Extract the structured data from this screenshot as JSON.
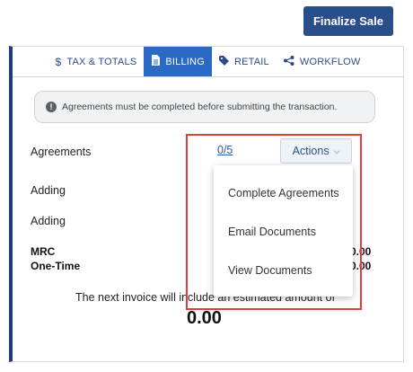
{
  "header": {
    "finalize_label": "Finalize Sale"
  },
  "tabs": [
    {
      "label": "TAX & TOTALS",
      "icon": "dollar-icon",
      "active": false
    },
    {
      "label": "BILLING",
      "icon": "document-icon",
      "active": true
    },
    {
      "label": "RETAIL",
      "icon": "tag-icon",
      "active": false
    },
    {
      "label": "WORKFLOW",
      "icon": "workflow-icon",
      "active": false
    }
  ],
  "notice": {
    "text": "Agreements must be completed before submitting the transaction."
  },
  "agreements": {
    "label": "Agreements",
    "count": "0/5",
    "actions_label": "Actions"
  },
  "rows": {
    "adding_1": "Adding",
    "adding_2": "Adding"
  },
  "totals": {
    "mrc_label": "MRC",
    "onetime_label": "One-Time",
    "mrc_value": "0.00",
    "onetime_value": "0.00",
    "next_invoice_text": "The next invoice will include an estimated amount of",
    "next_invoice_amount": "0.00"
  },
  "actions_menu": [
    {
      "label": "Complete Agreements"
    },
    {
      "label": "Email Documents"
    },
    {
      "label": "View Documents"
    }
  ],
  "colors": {
    "primary": "#2a4e8a",
    "active_tab": "#2a6ac4",
    "highlight": "#e53b3b"
  }
}
